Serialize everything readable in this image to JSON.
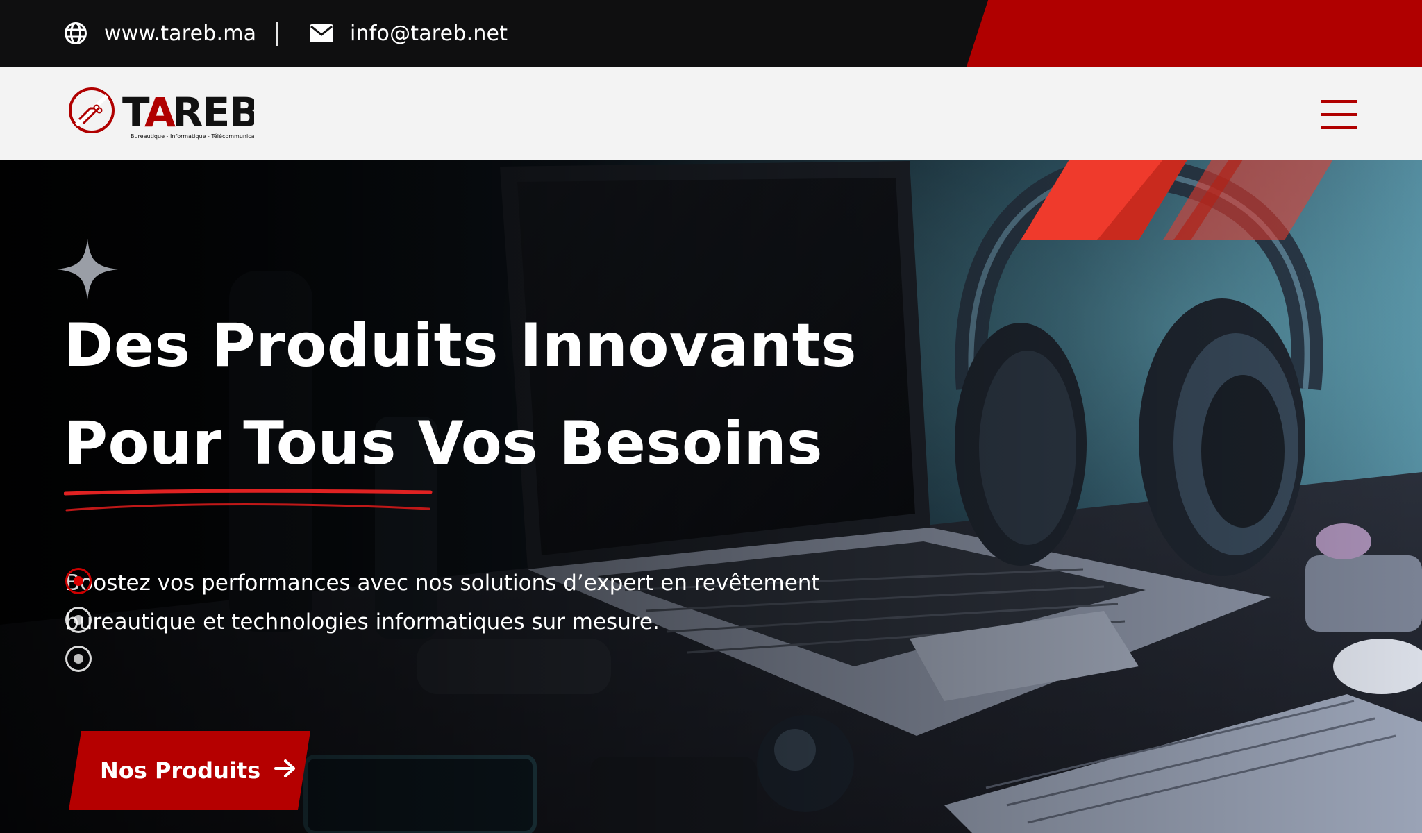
{
  "topbar": {
    "website": "www.tareb.ma",
    "email": "info@tareb.net",
    "accent_color": "#b00000",
    "icons": {
      "website": "globe-icon",
      "email": "envelope-icon"
    }
  },
  "brand": {
    "name": "TAREB",
    "tagline": "Bureautique - Informatique - Télécommunication",
    "color": "#b00000"
  },
  "nav": {
    "menu_icon": "hamburger-menu-icon"
  },
  "hero": {
    "title_line1": "Des Produits Innovants",
    "title_line2": "Pour Tous Vos Besoins",
    "subtitle": "Boostez vos performances avec nos solutions d’expert en revêtement bureautique et technologies informatiques sur mesure.",
    "cta_label": "Nos Produits",
    "cta_icon": "arrow-right-icon",
    "slider": {
      "count": 3,
      "active": 1
    }
  }
}
